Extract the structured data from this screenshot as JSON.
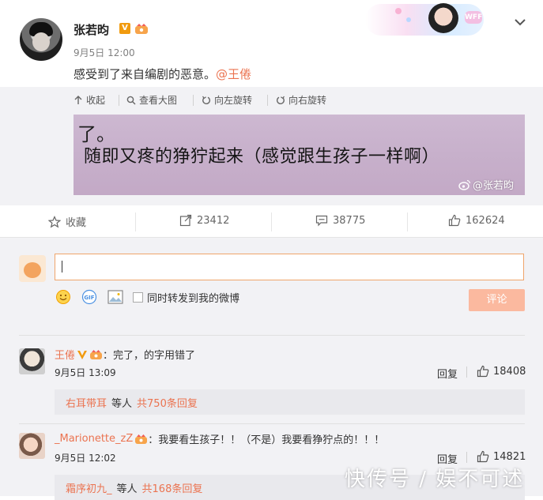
{
  "post": {
    "author": "张若昀",
    "verified_badge": "V",
    "time": "9月5日 12:00",
    "text_prefix": "感受到了来自编剧的恶意。",
    "mention": "@王倦",
    "banner_sticker": "WFF"
  },
  "media_toolbar": {
    "collapse": "收起",
    "view_large": "查看大图",
    "rotate_left": "向左旋转",
    "rotate_right": "向右旋转"
  },
  "image": {
    "line1": "了。",
    "line2": "随即又疼的狰狞起来（感觉跟生孩子一样啊）",
    "watermark": "@张若昀"
  },
  "actions": {
    "favorite": "收藏",
    "repost_count": "23412",
    "comment_count": "38775",
    "like_count": "162624"
  },
  "composer": {
    "repost_option": "同时转发到我的微博",
    "submit": "评论"
  },
  "comments": [
    {
      "user": "王倦",
      "text": "：完了，的字用错了",
      "time": "9月5日 13:09",
      "reply_label": "回复",
      "likes": "18408",
      "sub_reply_user": "右耳带耳",
      "sub_reply_mid": "等人",
      "sub_reply_count": "共750条回复"
    },
    {
      "user": "_Marionette_zZ",
      "text": "：我要看生孩子！！（不是）我要看狰狞点的！！！",
      "time": "9月5日 12:02",
      "reply_label": "回复",
      "likes": "14821",
      "sub_reply_user": "霜序初九_",
      "sub_reply_mid": "等人",
      "sub_reply_count": "共168条回复"
    }
  ],
  "page_watermark": "快传号 / 娱不可述",
  "colors": {
    "accent": "#eb7350",
    "badge_orange": "#f19b0f",
    "submit_disabled": "#fbb99f",
    "panel_bg": "#f2f2f5"
  }
}
